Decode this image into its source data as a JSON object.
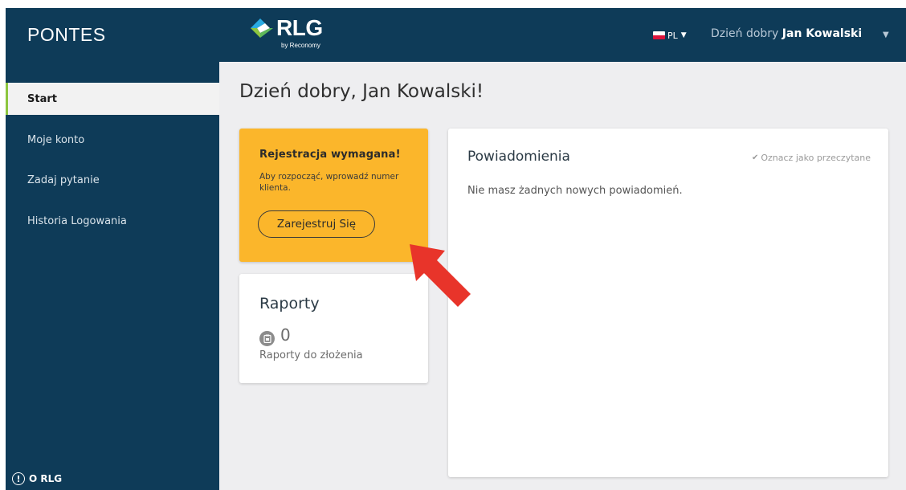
{
  "app": {
    "brand": "PONTES",
    "logo_text": "RLG",
    "logo_subtitle": "by Reconomy"
  },
  "header": {
    "language": "PL",
    "greeting_prefix": "Dzień dobry",
    "user_name": "Jan Kowalski"
  },
  "sidebar": {
    "items": [
      {
        "label": "Start",
        "active": true
      },
      {
        "label": "Moje konto",
        "active": false
      },
      {
        "label": "Zadaj pytanie",
        "active": false
      },
      {
        "label": "Historia Logowania",
        "active": false
      }
    ],
    "about_label": "O RLG"
  },
  "main": {
    "title": "Dzień dobry, Jan Kowalski!",
    "registration": {
      "title": "Rejestracja wymagana!",
      "text": "Aby rozpocząć, wprowadź numer klienta.",
      "button": "Zarejestruj Się"
    },
    "reports": {
      "title": "Raporty",
      "count": "0",
      "label": "Raporty do złożenia"
    },
    "notifications": {
      "title": "Powiadomienia",
      "mark_read": "Oznacz jako przeczytane",
      "empty": "Nie masz żadnych nowych powiadomień."
    }
  },
  "colors": {
    "navy": "#0e3b58",
    "accent_green": "#8dc63f",
    "registration_bg": "#fbb62b",
    "arrow_red": "#e8342a"
  },
  "icons": {
    "logo": "rlg-logo-icon",
    "flag": "poland-flag-icon",
    "info": "info-circle-icon",
    "reports": "clipboard-icon",
    "mark_read": "double-check-icon",
    "annotation": "red-arrow-icon"
  }
}
